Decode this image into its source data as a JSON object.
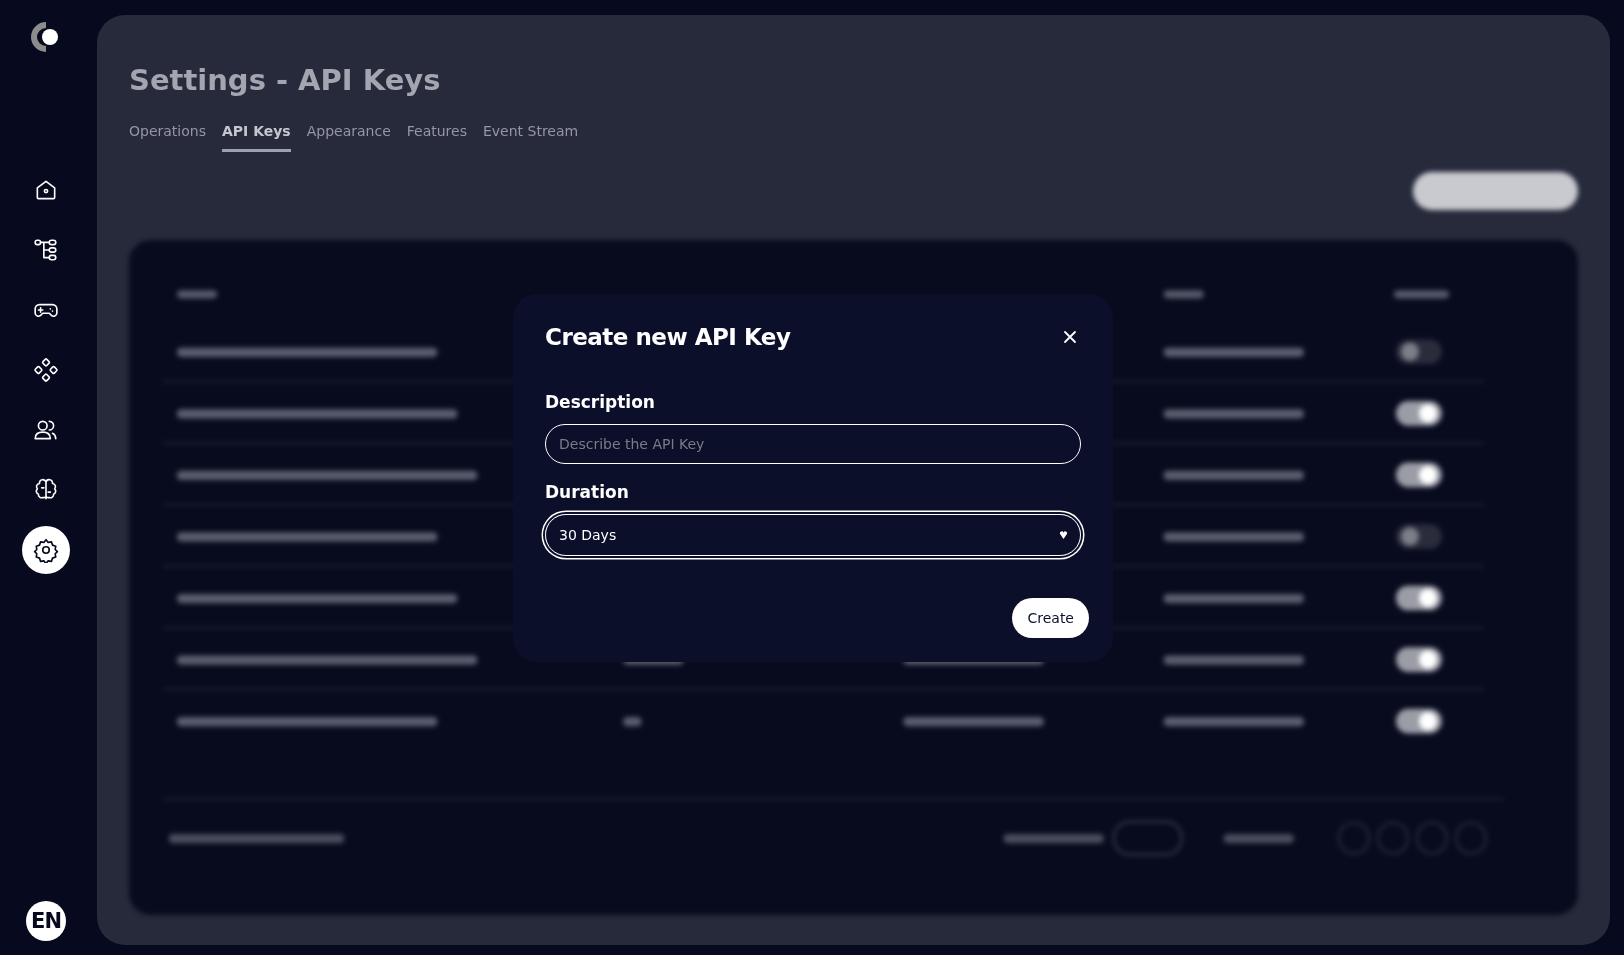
{
  "sidebar": {
    "items": [
      {
        "selected": false
      },
      {
        "selected": false
      },
      {
        "selected": false
      },
      {
        "selected": false
      },
      {
        "selected": false
      },
      {
        "selected": false
      },
      {
        "selected": true
      }
    ],
    "language": "EN"
  },
  "page": {
    "title": "Settings - API Keys",
    "tabs": [
      {
        "label": "Operations",
        "selected": false
      },
      {
        "label": "API Keys",
        "selected": true
      },
      {
        "label": "Appearance",
        "selected": false
      },
      {
        "label": "Features",
        "selected": false
      },
      {
        "label": "Event Stream",
        "selected": false
      }
    ],
    "table_toggles": [
      {
        "enabled": false
      },
      {
        "enabled": true
      },
      {
        "enabled": true
      },
      {
        "enabled": false
      },
      {
        "enabled": true
      },
      {
        "enabled": true
      },
      {
        "enabled": true
      }
    ]
  },
  "dialog": {
    "title": "Create new API Key",
    "fields": [
      {
        "kind": "text",
        "label": "Description",
        "placeholder": "Describe the API Key"
      },
      {
        "kind": "select",
        "label": "Duration",
        "value": "30 Days",
        "focused": true
      }
    ],
    "buttons": [
      "Create"
    ]
  }
}
